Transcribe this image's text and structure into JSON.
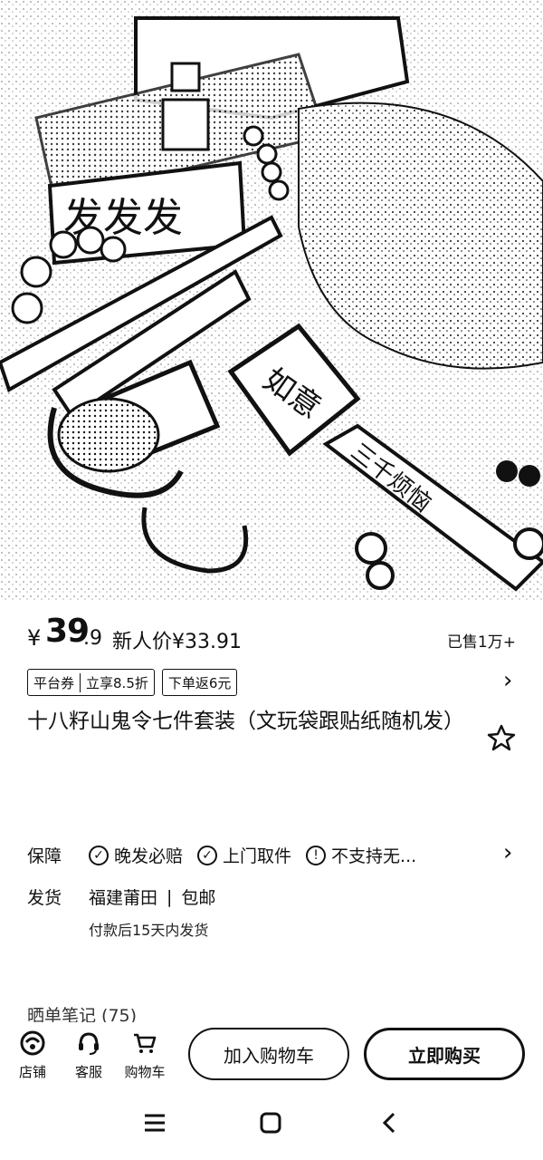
{
  "price": {
    "currency": "¥",
    "integer": "39",
    "decimal": ".9",
    "newcomer": "新人价¥33.91",
    "sold": "已售1万+"
  },
  "coupons": [
    {
      "parts": [
        "平台券",
        "立享8.5折"
      ]
    },
    {
      "parts": [
        "下单返6元"
      ]
    }
  ],
  "title": "十八籽山鬼令七件套装（文玩袋跟贴纸随机发）",
  "guarantee": {
    "label": "保障",
    "items": [
      "晚发必赔",
      "上门取件",
      "不支持无..."
    ]
  },
  "shipping": {
    "label": "发货",
    "origin": "福建莆田",
    "separator": "|",
    "free": "包邮",
    "note": "付款后15天内发货"
  },
  "faded_text": "晒单笔记 (75)",
  "bottom": {
    "shop": "店铺",
    "service": "客服",
    "cart": "购物车",
    "add_cart": "加入购物车",
    "buy_now": "立即购买"
  },
  "hero": {
    "sign1": "发发发",
    "sign2": "如意",
    "sign3": "三千烦恼"
  }
}
